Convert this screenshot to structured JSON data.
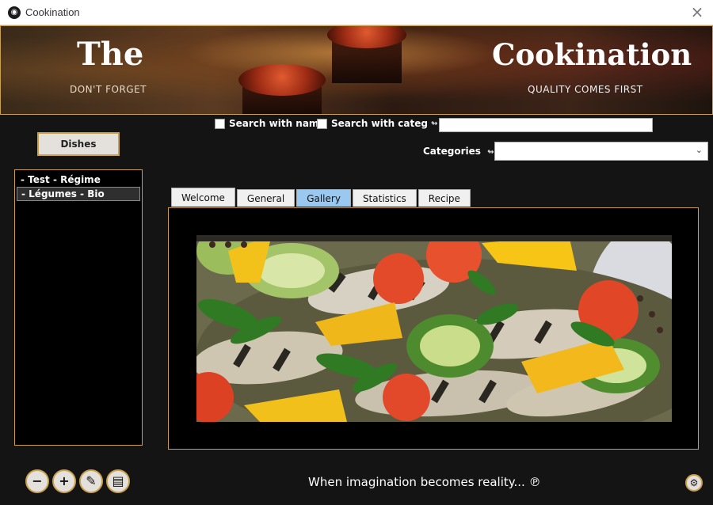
{
  "window": {
    "title": "Cookination",
    "close_glyph": "×"
  },
  "banner": {
    "left_title": "The",
    "left_subtitle": "DON'T FORGET",
    "right_title": "Cookination",
    "right_subtitle": "QUALITY COMES FIRST"
  },
  "search": {
    "with_name_label": "Search with name",
    "with_categ_label": "Search with categ",
    "categ_arrow": "↬",
    "input_value": "",
    "categories_label": "Categories",
    "categories_arrow": "↬",
    "categories_selected": ""
  },
  "dishes_button": "Dishes",
  "dish_list": [
    {
      "label": "- Test - Régime",
      "selected": false
    },
    {
      "label": "- Légumes - Bio",
      "selected": true
    }
  ],
  "tabs": [
    {
      "label": "Welcome",
      "active": false
    },
    {
      "label": "General",
      "active": false
    },
    {
      "label": "Gallery",
      "active": true
    },
    {
      "label": "Statistics",
      "active": false
    },
    {
      "label": "Recipe",
      "active": false
    }
  ],
  "toolbar": {
    "remove_glyph": "−",
    "add_glyph": "+",
    "edit_glyph": "✎",
    "card_glyph": "▤",
    "settings_glyph": "⚙"
  },
  "tagline": "When imagination becomes reality... ℗"
}
